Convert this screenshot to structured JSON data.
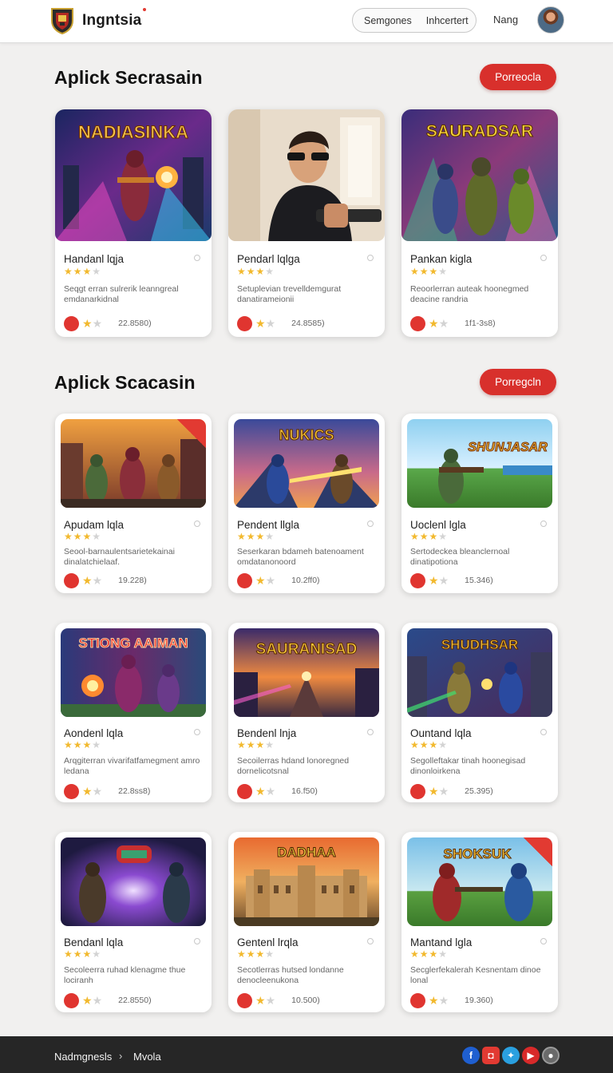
{
  "header": {
    "brand": "Ingntsia",
    "pill_left": "Semgones",
    "pill_right": "Inhcertert",
    "nav_link": "Nang"
  },
  "sections": [
    {
      "title": "Aplick Secrasain",
      "button": "Porreocla"
    },
    {
      "title": "Aplick Scacasin",
      "button": "Porregcln"
    }
  ],
  "thumb_texts": {
    "c1": "NADIASINKA",
    "c3": "SAURADSAR",
    "c5": "NUKICS",
    "c6": "SHUNJASAR",
    "c7": "STIONG AAIMAN",
    "c8": "SAURANISAD",
    "c9": "SHUDHSAR",
    "c11": "DADHAA",
    "c12": "SHOKSUK"
  },
  "cards": [
    {
      "title": "Handanl lqja",
      "desc": "Seqgt erran sulrerik leanngreal emdanarkidnal",
      "count": "22.8580)"
    },
    {
      "title": "Pendarl lqlga",
      "desc": "Setuplevian trevelldemgurat danatirameionii",
      "count": "24.8585)"
    },
    {
      "title": "Pankan kigla",
      "desc": "Reoorlerran auteak hoonegmed deacine randria",
      "count": "1f1-3s8)"
    },
    {
      "title": "Apudam lqla",
      "desc": "Seool-barnaulentsarietekainai dinalatchielaaf.",
      "count": "19.228)"
    },
    {
      "title": "Pendent llgla",
      "desc": "Seserkaran bdameh batenoament omdatanonoord",
      "count": "10.2ff0)"
    },
    {
      "title": "Uoclenl lgla",
      "desc": "Sertodeckea bleanclernoal dinatipotiona",
      "count": "15.346)"
    },
    {
      "title": "Aondenl lqla",
      "desc": "Arqgiterran vivarifatfamegment amro ledana",
      "count": "22.8ss8)"
    },
    {
      "title": "Bendenl lnja",
      "desc": "Secoilerras hdand lonoregned dornelicotsnal",
      "count": "16.f50)"
    },
    {
      "title": "Ountand lqla",
      "desc": "Segolleftakar tinah hoonegisad dinonloirkena",
      "count": "25.395)"
    },
    {
      "title": "Bendanl lqla",
      "desc": "Secoleerra ruhad klenagme thue lociranh",
      "count": "22.8550)"
    },
    {
      "title": "Gentenl lrqla",
      "desc": "Secotlerras hutsed londanne denocleenukona",
      "count": "10.500)"
    },
    {
      "title": "Mantand lgla",
      "desc": "Secglerfekalerah Kesnentam dinoe lonal",
      "count": "19.360)"
    }
  ],
  "footer": {
    "crumb_left": "Nadmgnesls",
    "crumb_sep": "›",
    "crumb_right": "Mvola"
  },
  "colors": {
    "accent": "#d8302c",
    "star": "#f2b92e",
    "footer_bg": "#262626"
  }
}
